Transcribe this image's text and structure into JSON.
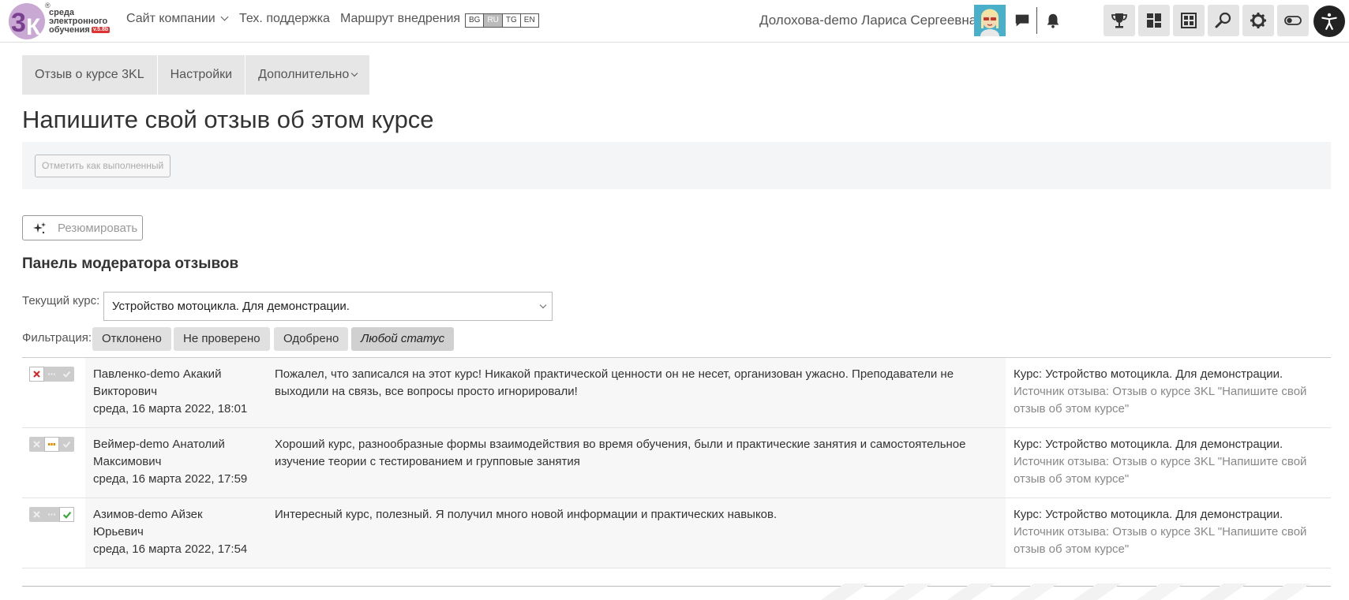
{
  "navbar": {
    "logo_lines": [
      "среда",
      "электронного",
      "обучения"
    ],
    "logo_version": "v.5.8b",
    "logo_reg": "®",
    "links": {
      "company": "Сайт компании",
      "support": "Тех. поддержка",
      "route": "Маршрут внедрения"
    },
    "languages": [
      "BG",
      "RU",
      "TG",
      "EN"
    ],
    "active_language": "RU",
    "user_name": "Долохова-demo Лариса Сергеевна",
    "tool_icons": [
      "trophy-icon",
      "dashboard-icon",
      "courses-icon",
      "search-icon",
      "gear-icon",
      "toggle-icon",
      "accessibility-icon"
    ]
  },
  "tabs": [
    "Отзыв о курсе 3KL",
    "Настройки",
    "Дополнительно"
  ],
  "page_title": "Напишите свой отзыв об этом курсе",
  "complete_button": "Отметить как выполненный",
  "summarize_button": "Резюмировать",
  "moderator": {
    "heading": "Панель модератора отзывов",
    "course_label": "Текущий курс:",
    "course_value": "Устройство мотоцикла. Для демонстрации.",
    "filter_label": "Фильтрация:",
    "filters": [
      "Отклонено",
      "Не проверено",
      "Одобрено",
      "Любой статус"
    ],
    "active_filter": "Любой статус"
  },
  "reviews": [
    {
      "status": "rejected",
      "author_line1": "Павленко-demo Акакий",
      "author_line2": "Викторович",
      "date": "среда, 16 марта 2022, 18:01",
      "text": "Пожалел, что записался на этот курс! Никакой практической ценности он не несет, организован ужасно. Преподаватели не выходили на связь, все вопросы просто игнорировали!",
      "course": "Курс: Устройство мотоцикла. Для демонстрации.",
      "source": "Источник отзыва: Отзыв о курсе 3KL \"Напишите свой отзыв об этом курсе\""
    },
    {
      "status": "unchecked",
      "author_line1": "Веймер-demo Анатолий",
      "author_line2": "Максимович",
      "date": "среда, 16 марта 2022, 17:59",
      "text": "Хороший курс, разнообразные формы взаимодействия во время обучения, были и практические занятия и самостоятельное изучение теории с тестированием и групповые занятия",
      "course": "Курс: Устройство мотоцикла. Для демонстрации.",
      "source": "Источник отзыва: Отзыв о курсе 3KL \"Напишите свой отзыв об этом курсе\""
    },
    {
      "status": "approved",
      "author_line1": "Азимов-demo Айзек",
      "author_line2": "Юрьевич",
      "date": "среда, 16 марта 2022, 17:54",
      "text": "Интересный курс, полезный. Я получил много новой информации и практических навыков.",
      "course": "Курс: Устройство мотоцикла. Для демонстрации.",
      "source": "Источник отзыва: Отзыв о курсе 3KL \"Напишите свой отзыв об этом курсе\""
    }
  ],
  "colors": {
    "tab_bg": "#e6e6e6",
    "reject": "#dd2222",
    "pending": "#e68a00",
    "approve": "#33aa33",
    "logo_purple": "#7b3f8f"
  }
}
